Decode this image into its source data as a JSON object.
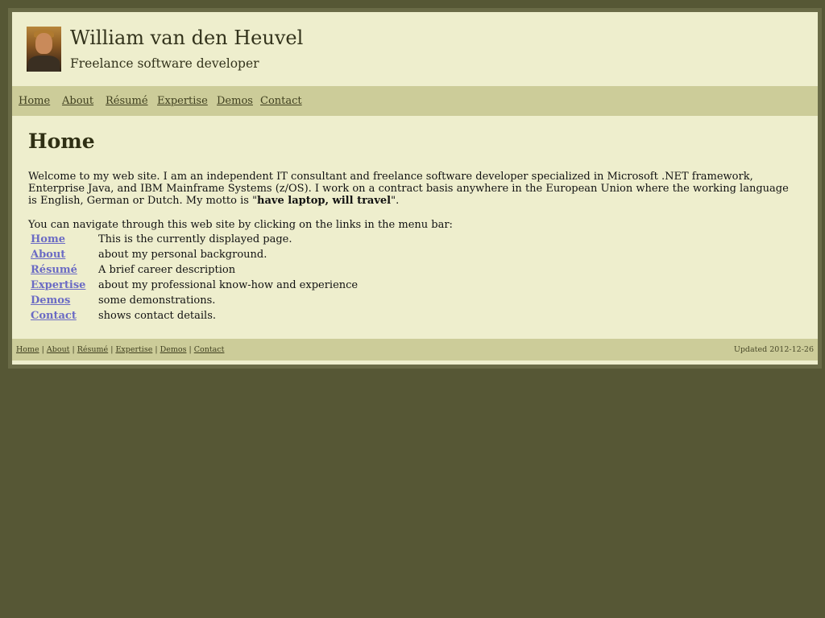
{
  "header": {
    "title": "William van den Heuvel",
    "subtitle": "Freelance software developer"
  },
  "menu": {
    "home": "Home",
    "about": "About",
    "resume": "Résumé",
    "expertise": "Expertise",
    "demos": "Demos",
    "contact": "Contact"
  },
  "main": {
    "heading": "Home",
    "intro_text": "Welcome to my web site. I am an independent IT consultant and freelance software developer specialized in Microsoft .NET framework, Enterprise Java, and IBM Mainframe Systems (z/OS). I work on a contract basis anywhere in the European Union where the working language is English, German or Dutch. My motto is \"",
    "motto": "have laptop, will travel",
    "intro_end": "\".",
    "nav_intro": "You can navigate through this web site by clicking on the links in the menu bar:",
    "nav_items": [
      {
        "label": "Home",
        "desc": "This is the currently displayed page."
      },
      {
        "label": "About",
        "desc": "about my personal background."
      },
      {
        "label": "Résumé",
        "desc": "A brief career description"
      },
      {
        "label": "Expertise",
        "desc": "about my professional know-how and experience"
      },
      {
        "label": "Demos",
        "desc": "some demonstrations."
      },
      {
        "label": "Contact",
        "desc": "shows contact details."
      }
    ]
  },
  "footer": {
    "links": [
      "Home",
      "About",
      "Résumé",
      "Expertise",
      "Demos",
      "Contact"
    ],
    "separator": "|",
    "updated": "Updated 2012-12-26"
  },
  "colors": {
    "page_background": "#565735",
    "content_background": "#eeeecd",
    "bar_background": "#cccc99",
    "link_color": "#6b6bc4"
  }
}
